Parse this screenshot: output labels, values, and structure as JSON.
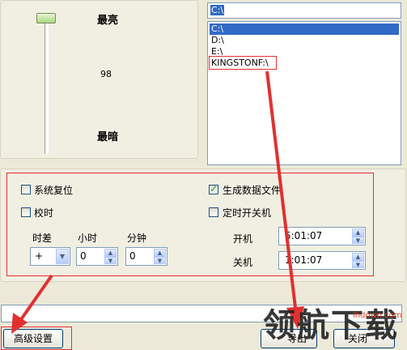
{
  "brightness": {
    "max_label": "最亮",
    "value": "98",
    "min_label": "最暗",
    "level": 0.98
  },
  "drive_list": {
    "current_value": "C:\\",
    "items": [
      "C:\\",
      "D:\\",
      "E:\\",
      "KINGSTONF:\\"
    ],
    "selected_index": 0
  },
  "options": {
    "system_reset": {
      "label": "系统复位",
      "checked": false
    },
    "generate_data_file": {
      "label": "生成数据文件",
      "checked": true
    },
    "time_sync": {
      "label": "校时",
      "checked": false
    },
    "scheduled_power": {
      "label": "定时开关机",
      "checked": false
    }
  },
  "time_offset": {
    "timezone_label": "时差",
    "hour_label": "小时",
    "minute_label": "分钟",
    "sign_value": "+",
    "hour_value": "0",
    "minute_value": "0"
  },
  "schedule": {
    "power_on_label": "开机",
    "power_on_time": "5:01:07",
    "power_off_label": "关机",
    "power_off_time": "1:01:07"
  },
  "buttons": {
    "advanced_label": "高级设置",
    "export_label": "导出",
    "close_label": "关闭"
  },
  "watermark": {
    "text": "领航下载",
    "url": "lhdown.com"
  },
  "colors": {
    "window_bg": "#ece9d8",
    "highlight": "#e23030",
    "selection": "#316ac5"
  }
}
